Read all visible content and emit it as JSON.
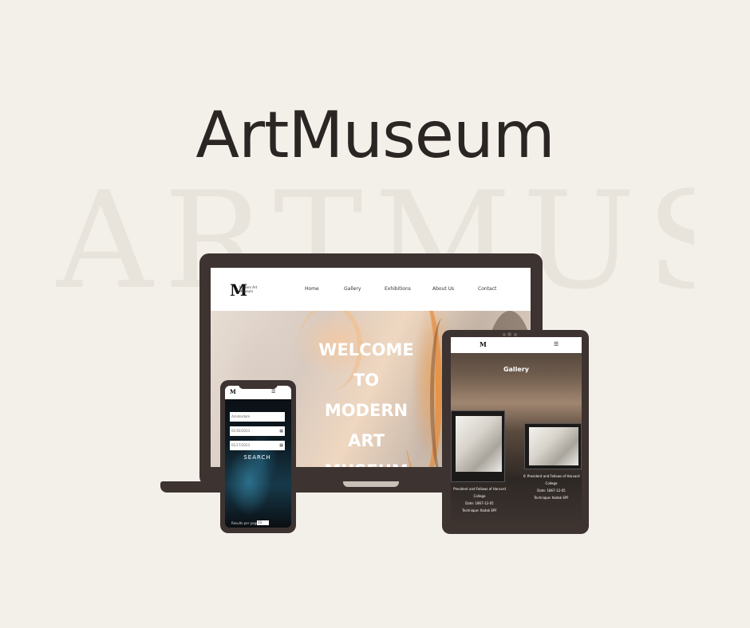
{
  "brand": {
    "title": "ArtMuseum",
    "watermark": "ARTMUS"
  },
  "laptop": {
    "logo_mark": "M",
    "logo_text": "Modern Art Museum",
    "nav": [
      "Home",
      "Gallery",
      "Exhibitions",
      "About Us",
      "Contact"
    ],
    "hero_lines": [
      "WELCOME",
      "TO",
      "MODERN",
      "ART",
      "MUSEUM"
    ]
  },
  "tablet": {
    "logo_mark": "M",
    "menu_icon": "hamburger-icon",
    "gallery_title": "Gallery",
    "cards": [
      {
        "owner": "President and Fellows of Harvard College",
        "date": "Date: 1867-12-05",
        "technique": "Technique: Kodak EPF"
      },
      {
        "owner": "© President and Fellows of Harvard College",
        "date": "Date: 1867-12-05",
        "technique": "Technique: Kodak EPF"
      }
    ]
  },
  "phone": {
    "logo_mark": "M",
    "menu_icon": "hamburger-icon",
    "fields": [
      {
        "value": "Amsterdam",
        "has_calendar": false
      },
      {
        "value": "01/02/2023",
        "has_calendar": true
      },
      {
        "value": "01/17/2023",
        "has_calendar": true
      }
    ],
    "search_label": "SEARCH",
    "results_label": "Results per page:",
    "results_value": "10"
  },
  "colors": {
    "background": "#f3f0ea",
    "device": "#3d3330",
    "headline": "#2b2523"
  }
}
